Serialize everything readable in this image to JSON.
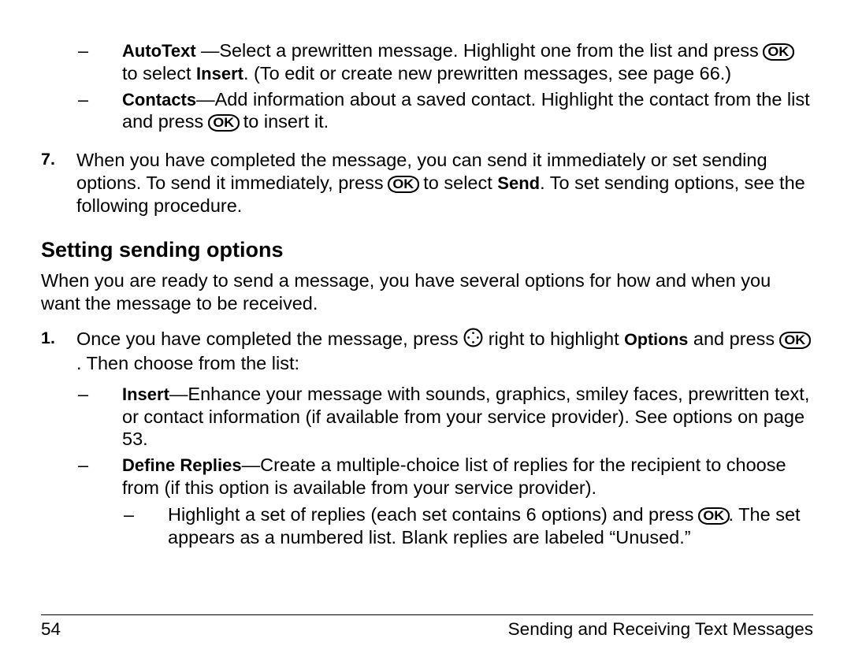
{
  "top_list": {
    "autotext": {
      "label": "AutoText ",
      "before_icon_1": "—Select a prewritten message. Highlight one from the list and press ",
      "after_icon_1": " to select ",
      "insert_label": "Insert",
      "tail": ". (To edit or create new prewritten messages, see page 66.)"
    },
    "contacts": {
      "label": "Contacts",
      "before_icon": "—Add information about a saved contact. Highlight the contact from the list and press ",
      "after_icon": " to insert it."
    }
  },
  "step7": {
    "num": "7.",
    "before_icon": "When you have completed the message, you can send it immediately or set sending options. To send it immediately, press ",
    "mid1": " to select ",
    "send_label": "Send",
    "tail": ". To set sending options, see the following procedure."
  },
  "heading": "Setting sending options",
  "intro": "When you are ready to send a message, you have several options for how and when you want the message to be received.",
  "step1": {
    "num": "1.",
    "before_nav": "Once you have completed the message, press ",
    "after_nav_before_opts": " right to highlight ",
    "options_label": "Options",
    "after_opts_before_ok": " and press ",
    "after_ok": ". Then choose from the list:"
  },
  "step1_list": {
    "insert": {
      "label": "Insert",
      "body": "—Enhance your message with sounds, graphics, smiley faces, prewritten text, or contact information (if available from your service provider). See options on page 53."
    },
    "define": {
      "label": "Define Replies",
      "body": "—Create a multiple-choice list of replies for the recipient to choose from (if this option is available from your service provider)."
    },
    "sub": {
      "before_ok": "Highlight a set of replies (each set contains 6 options) and press ",
      "after_ok": ". The set appears as a numbered list. Blank replies are labeled “Unused.”"
    }
  },
  "footer": {
    "page_num": "54",
    "section": "Sending and Receiving Text Messages"
  },
  "icons": {
    "ok": "OK"
  }
}
